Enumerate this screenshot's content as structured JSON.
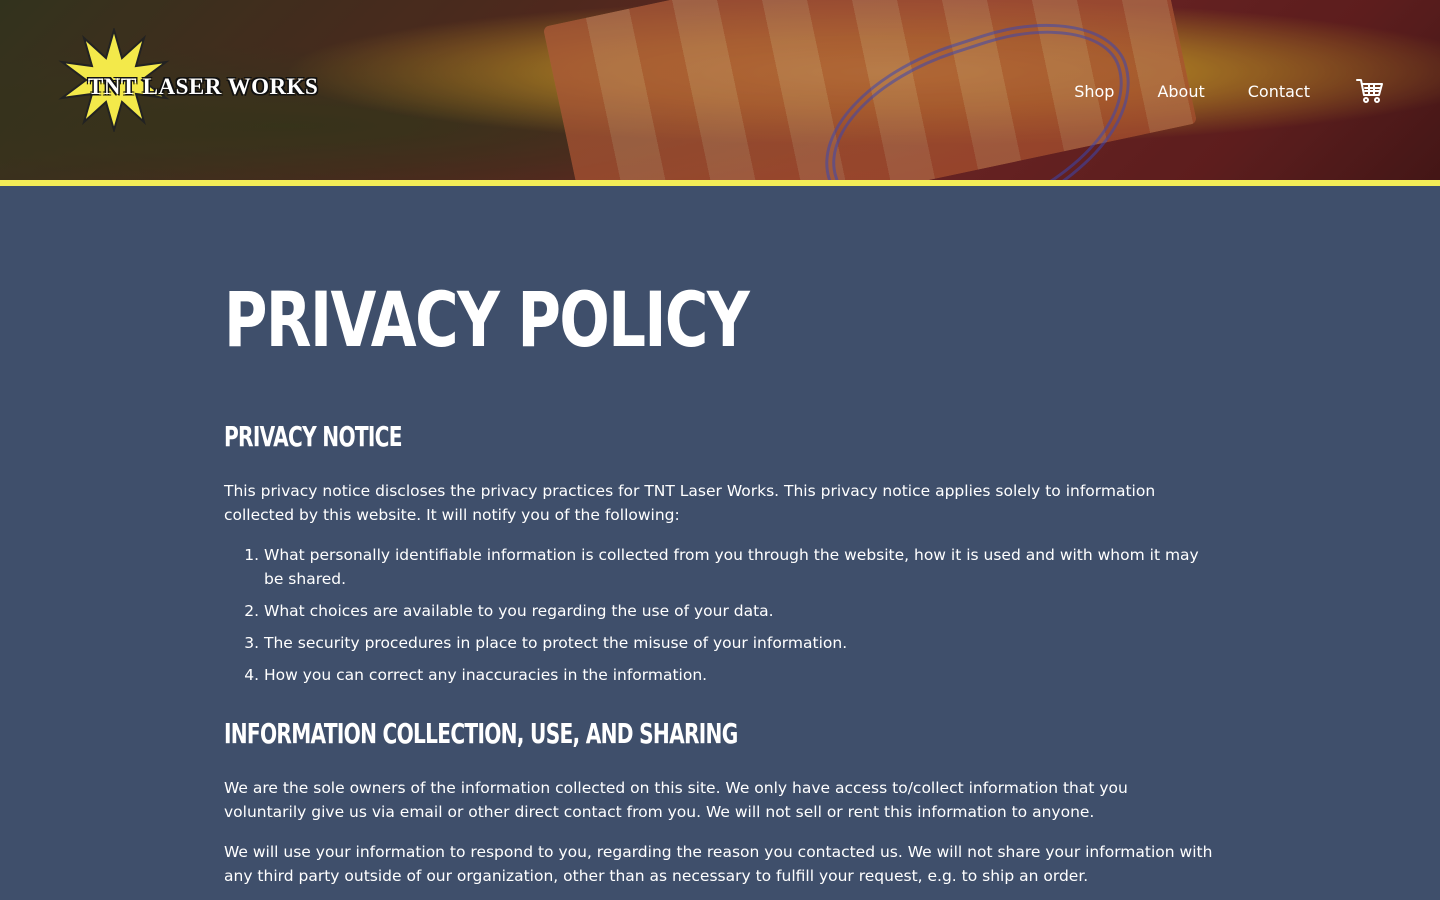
{
  "brand": {
    "logo_text": "TNT LASER WORKS"
  },
  "nav": {
    "items": [
      {
        "label": "Shop"
      },
      {
        "label": "About"
      },
      {
        "label": "Contact"
      }
    ],
    "cart_icon": "shopping-cart-icon"
  },
  "colors": {
    "background": "#3f4f6b",
    "accent_stripe": "#f3ec57",
    "text": "#ffffff"
  },
  "page": {
    "title": "PRIVACY POLICY",
    "sections": [
      {
        "heading": "PRIVACY NOTICE",
        "intro": "This privacy notice discloses the privacy practices for TNT Laser Works. This privacy notice applies solely to information collected by this website. It will notify you of the following:",
        "list": [
          "What personally identifiable information is collected from you through the website, how it is used and with whom it may be shared.",
          "What choices are available to you regarding the use of your data.",
          "The security procedures in place to protect the misuse of your information.",
          "How you can correct any inaccuracies in the information."
        ]
      },
      {
        "heading": "INFORMATION COLLECTION, USE, AND SHARING",
        "paragraphs": [
          "We are the sole owners of the information collected on this site. We only have access to/collect information that you voluntarily give us via email or other direct contact from you. We will not sell or rent this information to anyone.",
          "We will use your information to respond to you, regarding the reason you contacted us. We will not share your information with any third party outside of our organization, other than as necessary to fulfill your request, e.g. to ship an order."
        ]
      }
    ]
  }
}
